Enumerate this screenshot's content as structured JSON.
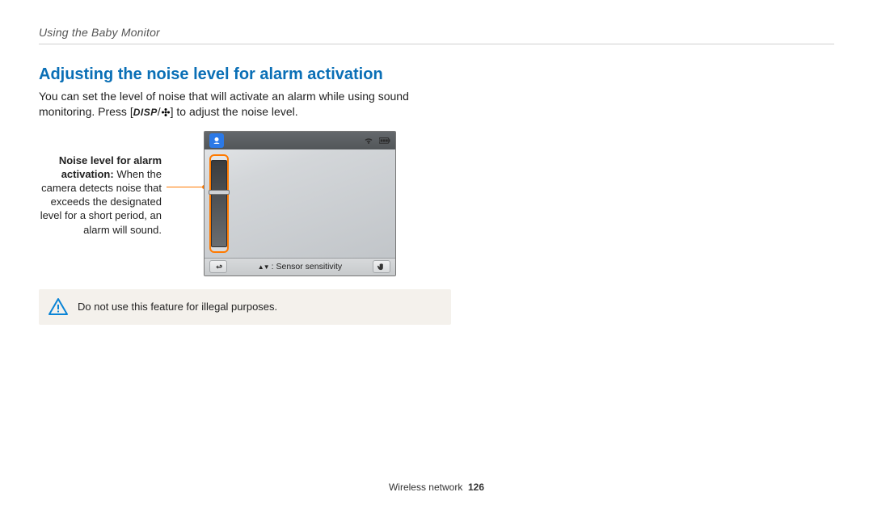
{
  "breadcrumb": "Using the Baby Monitor",
  "heading": "Adjusting the noise level for alarm activation",
  "body_line1": "You can set the level of noise that will activate an alarm while using sound",
  "body_line2_a": "monitoring. Press [",
  "body_line2_disp": "DISP",
  "body_line2_b": "] to adjust the noise level.",
  "callout": {
    "title": "Noise level for alarm activation",
    "colon": ":",
    "desc": "When the camera detects noise that exceeds the designated level for a short period, an alarm will sound."
  },
  "bottombar_label": "Sensor sensitivity",
  "warning": "Do not use this feature for illegal purposes.",
  "footer_section": "Wireless network",
  "footer_page": "126"
}
